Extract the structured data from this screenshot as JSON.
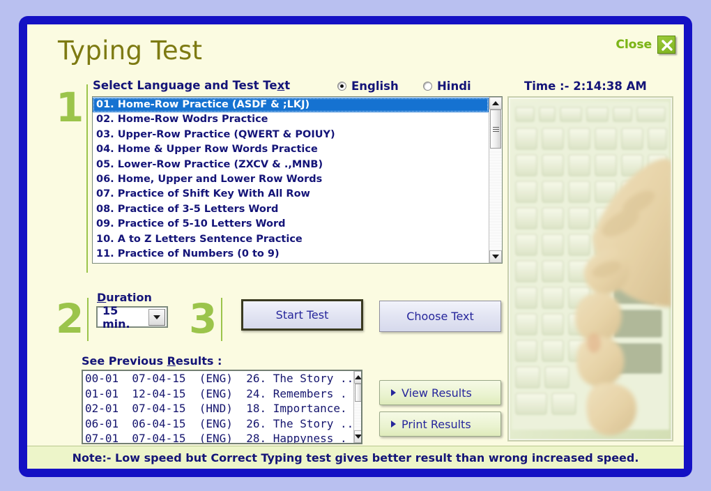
{
  "window": {
    "title": "Typing Test",
    "close_label": "Close",
    "frame_color": "#1411c4",
    "body_color": "#fbfbe1",
    "accent_green": "#9bc44b",
    "text_blue": "#141478"
  },
  "steps": {
    "one": "1",
    "two": "2",
    "three": "3"
  },
  "section_language": {
    "heading_pre": "Select Language and Test Te",
    "heading_underlined": "x",
    "heading_post": "t",
    "radios": [
      {
        "label": "English",
        "selected": true
      },
      {
        "label": "Hindi",
        "selected": false
      }
    ],
    "time_label": "Time :-  2:14:38 AM",
    "items": [
      {
        "text": "01. Home-Row Practice (ASDF & ;LKJ)",
        "selected": true
      },
      {
        "text": "02. Home-Row Wodrs Practice",
        "selected": false
      },
      {
        "text": "03. Upper-Row Practice (QWERT & POIUY)",
        "selected": false
      },
      {
        "text": "04. Home & Upper Row Words Practice",
        "selected": false
      },
      {
        "text": "05. Lower-Row Practice (ZXCV & .,MNB)",
        "selected": false
      },
      {
        "text": "06. Home, Upper and Lower Row Words",
        "selected": false
      },
      {
        "text": "07. Practice of Shift Key With All Row",
        "selected": false
      },
      {
        "text": "08. Practice of 3-5 Letters Word",
        "selected": false
      },
      {
        "text": "09. Practice of 5-10 Letters Word",
        "selected": false
      },
      {
        "text": "10. A to Z Letters Sentence Practice",
        "selected": false
      },
      {
        "text": "11. Practice of Numbers (0 to 9)",
        "selected": false
      }
    ]
  },
  "section_duration": {
    "label_underlined": "D",
    "label_rest": "uration",
    "selected_value": "15 min."
  },
  "section_actions": {
    "start_test_label": "Start Test",
    "choose_text_label": "Choose Text"
  },
  "section_results": {
    "heading_pre": "See Previous ",
    "heading_underlined": "R",
    "heading_post": "esults :",
    "rows": [
      "00-01  07-04-15  (ENG)  26. The Story ..",
      "01-01  12-04-15  (ENG)  24. Remembers .",
      "02-01  07-04-15  (HND)  18. Importance.",
      "06-01  06-04-15  (ENG)  26. The Story ..",
      "07-01  07-04-15  (ENG)  28. Happyness ."
    ],
    "view_label": "View Results",
    "print_label": "Print Results"
  },
  "note": {
    "text": "Note:- Low speed but Correct Typing test gives better result than wrong increased speed."
  }
}
